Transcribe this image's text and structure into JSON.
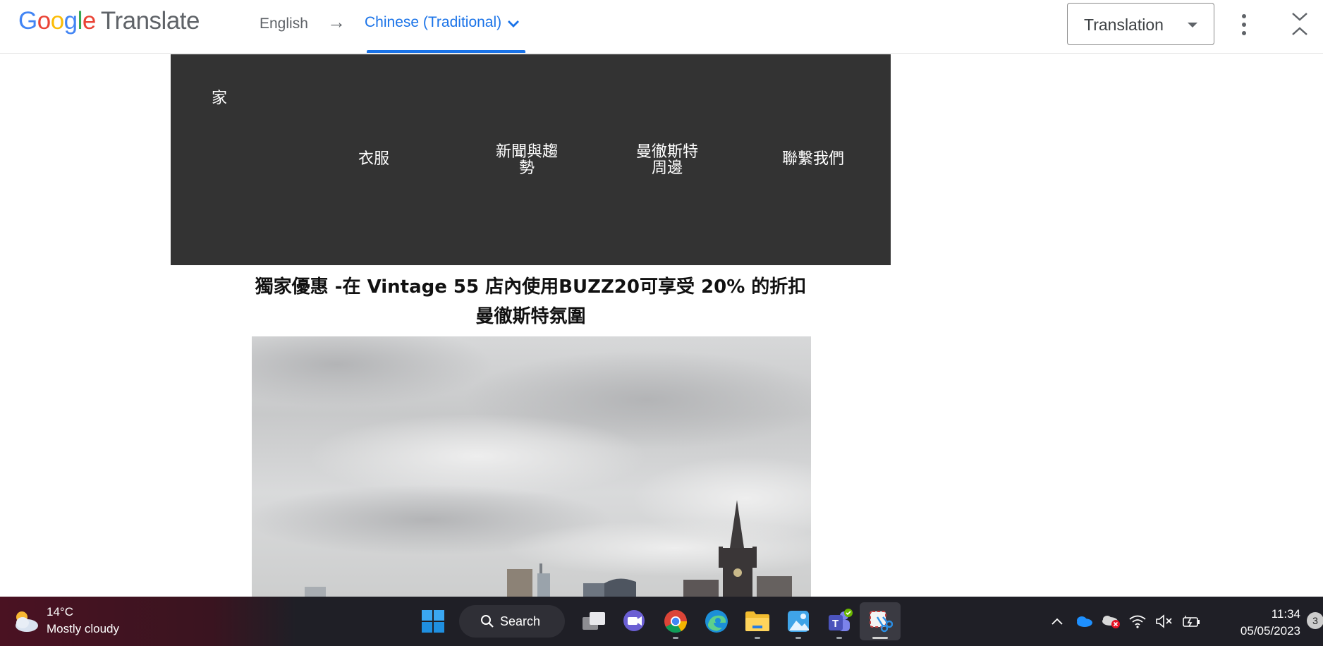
{
  "translate_bar": {
    "logo_letters": [
      "G",
      "o",
      "o",
      "g",
      "l",
      "e"
    ],
    "product": "Translate",
    "source_lang": "English",
    "arrow": "→",
    "target_lang": "Chinese (Traditional)",
    "mode": "Translation",
    "colors": {
      "accent": "#1a73e8"
    }
  },
  "site": {
    "nav": {
      "home": "家",
      "items": [
        {
          "label": "衣服"
        },
        {
          "label_line1": "新聞與趨",
          "label_line2": "勢"
        },
        {
          "label_line1": "曼徹斯特",
          "label_line2": "周邊"
        },
        {
          "label": "聯繫我們"
        }
      ]
    },
    "promo_line1": "獨家優惠 -在 Vintage 55 店內使用BUZZ20可享受 20% 的折扣",
    "promo_line2": "曼徹斯特氛圍"
  },
  "taskbar": {
    "weather": {
      "temp": "14°C",
      "condition": "Mostly cloudy"
    },
    "search_label": "Search",
    "apps": [
      "task-view",
      "teams-chat",
      "chrome",
      "edge",
      "file-explorer",
      "photos",
      "teams",
      "snipping-tool"
    ],
    "tray": [
      "chevron-up",
      "onedrive",
      "onedrive-error",
      "wifi",
      "volume-muted",
      "battery"
    ],
    "time": "11:34",
    "date": "05/05/2023",
    "notification_count": "3"
  }
}
